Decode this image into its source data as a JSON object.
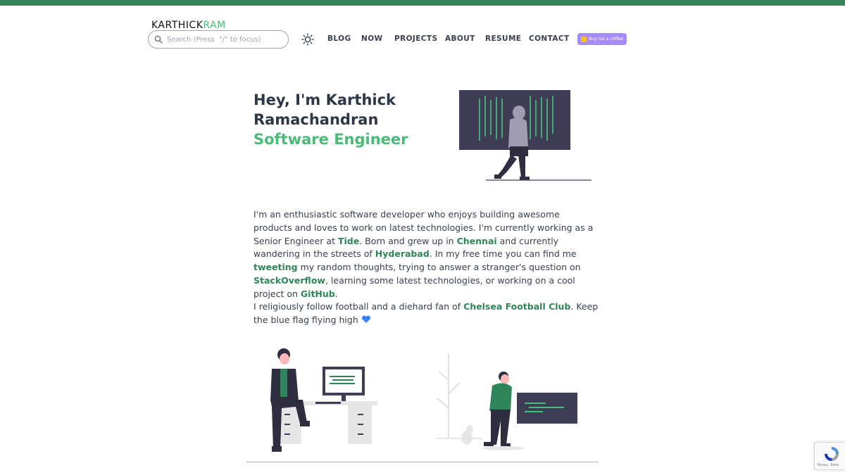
{
  "header": {
    "logo_part1": "KARTHICK",
    "logo_part2": "RAM",
    "search_placeholder": "Search (Press  \"/\" to focus)",
    "theme_toggle_icon": "sun-icon",
    "nav": [
      {
        "label": "BLOG"
      },
      {
        "label": "NOW"
      },
      {
        "label": "PROJECTS"
      },
      {
        "label": "ABOUT"
      },
      {
        "label": "RESUME"
      },
      {
        "label": "CONTACT"
      }
    ],
    "buy_coffee_label": "Buy me a coffee"
  },
  "hero": {
    "title": "Hey, I'm Karthick Ramachandran",
    "subtitle": "Software Engineer"
  },
  "about": {
    "p1_t1": "I'm an enthusiastic software developer who enjoys building awesome products and loves to work on latest technologies. I'm currently working as a Senior Engineer at ",
    "p1_l1": "Tide",
    "p1_t2": ". Born and grew up in ",
    "p1_l2": "Chennai",
    "p1_t3": " and currently wandering in the streets of ",
    "p1_l3": "Hyderabad",
    "p1_t4": ". In my free time you can find me ",
    "p1_l4": "tweeting",
    "p1_t5": " my random thoughts, trying to answer a stranger's question on ",
    "p1_l5": "StackOverflow",
    "p1_t6": ", learning some latest technologies, or working on a cool project on ",
    "p1_l6": "GitHub",
    "p1_t7": ".",
    "p2_t1": "I religiously follow football and a diehard fan of ",
    "p2_l1": "Chelsea Football Club",
    "p2_t2": ". Keep the blue flag flying high "
  },
  "recaptcha": {
    "terms": "Privacy - Terms"
  },
  "colors": {
    "accent": "#48bb78",
    "link": "#2f855a",
    "topbar": "#38845a",
    "coffee": "#a78bfa"
  }
}
